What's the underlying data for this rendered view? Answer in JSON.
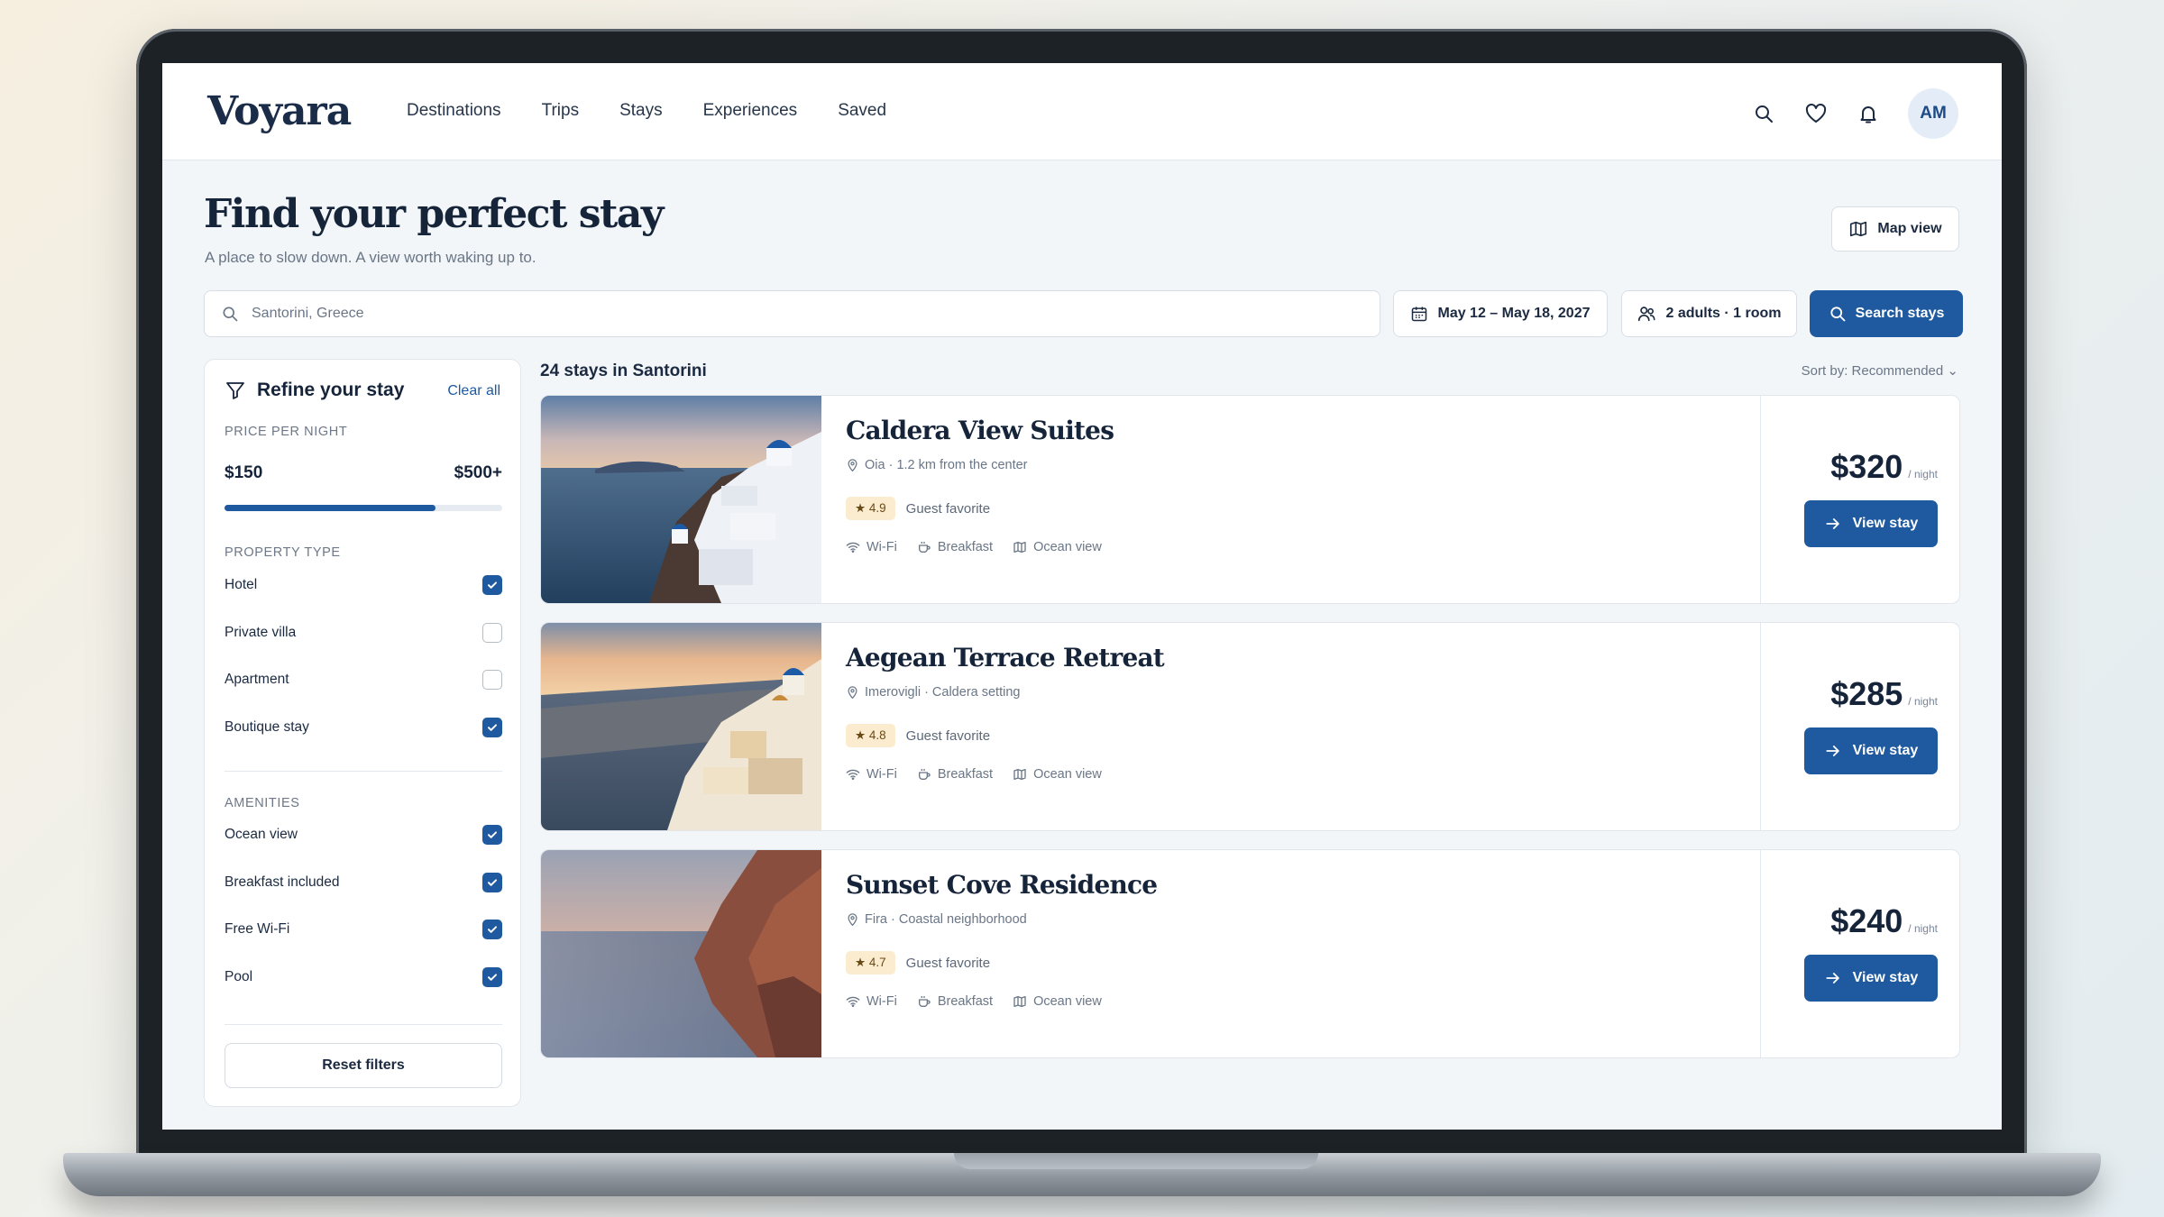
{
  "app": {
    "logo": "Voyara"
  },
  "nav": [
    "Destinations",
    "Trips",
    "Stays",
    "Experiences",
    "Saved"
  ],
  "user": {
    "initials": "AM"
  },
  "page": {
    "title": "Find your perfect stay",
    "subtitle": "A place to slow down. A view worth waking up to.",
    "map_view_label": "Map view"
  },
  "search": {
    "value": "Santorini, Greece",
    "dates": "May 12 – May 18, 2027",
    "guests": "2 adults · 1 room",
    "button_label": "Search stays"
  },
  "filters": {
    "title": "Refine your stay",
    "clear_label": "Clear all",
    "price_label": "PRICE PER NIGHT",
    "price_min": "$150",
    "price_max": "$500+",
    "price_fill_fraction": 0.76,
    "property_type_label": "PROPERTY TYPE",
    "property_types": [
      {
        "label": "Hotel",
        "checked": true
      },
      {
        "label": "Private villa",
        "checked": false
      },
      {
        "label": "Apartment",
        "checked": false
      },
      {
        "label": "Boutique stay",
        "checked": true
      }
    ],
    "amenities_label": "AMENITIES",
    "amenities": [
      {
        "label": "Ocean view",
        "checked": true
      },
      {
        "label": "Breakfast included",
        "checked": true
      },
      {
        "label": "Free Wi-Fi",
        "checked": true
      },
      {
        "label": "Pool",
        "checked": true
      }
    ],
    "reset_label": "Reset filters"
  },
  "results": {
    "count_text": "24 stays in Santorini",
    "sort_text": "Sort by: Recommended",
    "per_night": "/ night",
    "view_label": "View stay",
    "amenity_labels": [
      "Wi-Fi",
      "Breakfast",
      "Ocean view"
    ],
    "stays": [
      {
        "name": "Caldera View Suites",
        "location": "Oia · 1.2 km from the center",
        "rating": "4.9",
        "rating_text": "Guest favorite",
        "price": "$320"
      },
      {
        "name": "Aegean Terrace Retreat",
        "location": "Imerovigli · Caldera setting",
        "rating": "4.8",
        "rating_text": "Guest favorite",
        "price": "$285"
      },
      {
        "name": "Sunset Cove Residence",
        "location": "Fira · Coastal neighborhood",
        "rating": "4.7",
        "rating_text": "Guest favorite",
        "price": "$240"
      }
    ]
  },
  "colors": {
    "accent": "#1f5aa0",
    "ink": "#16243a",
    "rating_bg": "#fbecd0"
  }
}
